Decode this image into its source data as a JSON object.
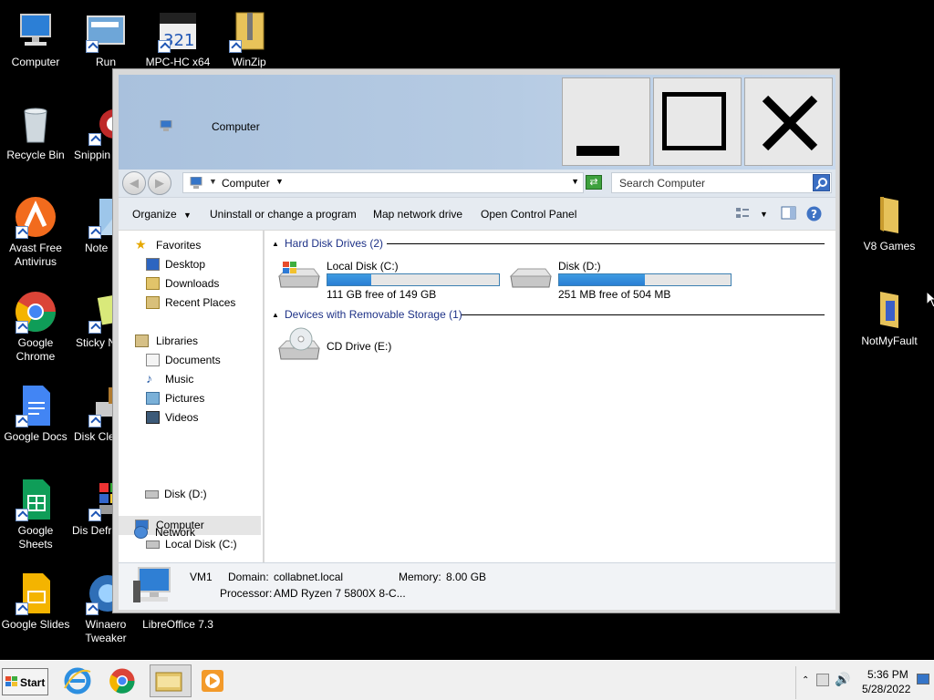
{
  "desktop": {
    "icons_left": [
      {
        "label": "Computer",
        "icon": "computer-icon"
      },
      {
        "label": "Run",
        "icon": "run-icon"
      },
      {
        "label": "MPC-HC x64",
        "icon": "mpc-hc-icon"
      },
      {
        "label": "WinZip",
        "icon": "winzip-icon"
      },
      {
        "label": "Recycle Bin",
        "icon": "recycle-bin-icon"
      },
      {
        "label": "Snippin",
        "icon": "snipping-tool-icon"
      },
      {
        "label": "Avast Free Antivirus",
        "icon": "avast-icon"
      },
      {
        "label": "Note",
        "icon": "notepad-icon"
      },
      {
        "label": "Google Chrome",
        "icon": "chrome-icon"
      },
      {
        "label": "Sticky N",
        "icon": "sticky-notes-icon"
      },
      {
        "label": "Google Docs",
        "icon": "google-docs-icon"
      },
      {
        "label": "Disk Cle",
        "icon": "disk-cleanup-icon"
      },
      {
        "label": "Google Sheets",
        "icon": "google-sheets-icon"
      },
      {
        "label": "Dis Defragm",
        "icon": "defrag-icon"
      },
      {
        "label": "Google Slides",
        "icon": "google-slides-icon"
      },
      {
        "label": "Winaero Tweaker",
        "icon": "winaero-icon"
      },
      {
        "label": "LibreOffice 7.3",
        "icon": "libreoffice-icon"
      }
    ],
    "icons_right": [
      {
        "label": "V8 Games",
        "icon": "folder-icon"
      },
      {
        "label": "NotMyFault",
        "icon": "folder-icon"
      }
    ]
  },
  "window": {
    "title": "Computer",
    "address": {
      "crumb": "Computer"
    },
    "search_placeholder": "Search Computer",
    "toolbar": {
      "organize": "Organize",
      "uninstall": "Uninstall or change a program",
      "map_drive": "Map network drive",
      "control_panel": "Open Control Panel"
    },
    "nav": {
      "favorites": "Favorites",
      "desktop": "Desktop",
      "downloads": "Downloads",
      "recent": "Recent Places",
      "libraries": "Libraries",
      "documents": "Documents",
      "music": "Music",
      "pictures": "Pictures",
      "videos": "Videos",
      "computer": "Computer",
      "local_disk": "Local Disk (C:)",
      "disk_d": "Disk (D:)",
      "network": "Network"
    },
    "groups": {
      "hdd": "Hard Disk Drives (2)",
      "removable": "Devices with Removable Storage (1)"
    },
    "drives": {
      "c": {
        "name": "Local Disk (C:)",
        "info": "111 GB free of 149 GB",
        "used_fraction": 0.255
      },
      "d": {
        "name": "Disk (D:)",
        "info": "251 MB free of 504 MB",
        "used_fraction": 0.5
      },
      "e": {
        "name": "CD Drive (E:)"
      }
    },
    "details": {
      "name": "VM1",
      "domain_label": "Domain:",
      "domain": "collabnet.local",
      "memory_label": "Memory:",
      "memory": "8.00 GB",
      "processor_label": "Processor:",
      "processor": "AMD Ryzen 7 5800X 8-C..."
    }
  },
  "taskbar": {
    "start": "Start",
    "time": "5:36 PM",
    "date": "5/28/2022",
    "apps": [
      "internet-explorer-icon",
      "chrome-icon",
      "explorer-icon",
      "media-player-icon"
    ]
  }
}
